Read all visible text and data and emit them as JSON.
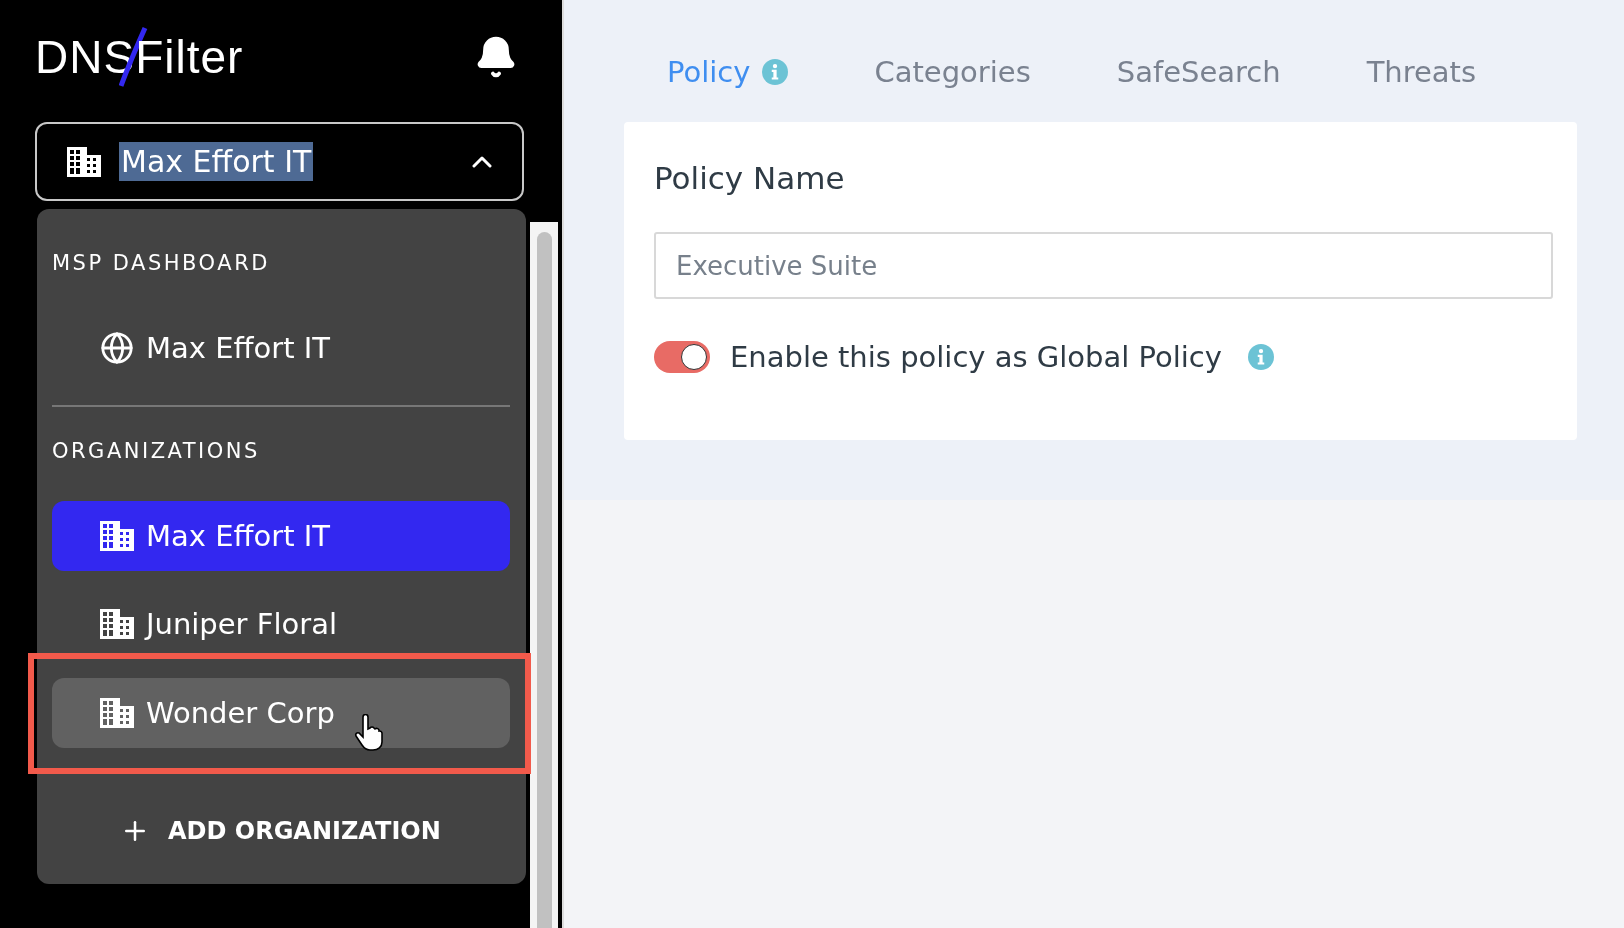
{
  "logo": {
    "left": "DNS",
    "right": "Filter"
  },
  "org_switcher": {
    "label": "Max Effort IT",
    "text_selected": true,
    "expanded": true
  },
  "menu": {
    "sections": [
      {
        "title": "MSP DASHBOARD",
        "items": [
          {
            "kind": "msp",
            "label": "Max Effort IT",
            "selected": false,
            "hovered": false,
            "highlighted": false
          }
        ]
      },
      {
        "title": "ORGANIZATIONS",
        "items": [
          {
            "kind": "org",
            "label": "Max Effort IT",
            "selected": true,
            "hovered": false,
            "highlighted": false
          },
          {
            "kind": "org",
            "label": "Juniper Floral",
            "selected": false,
            "hovered": false,
            "highlighted": false
          },
          {
            "kind": "org",
            "label": "Wonder Corp",
            "selected": false,
            "hovered": true,
            "highlighted": true
          }
        ]
      }
    ],
    "add_button": "ADD ORGANIZATION"
  },
  "tabs": [
    {
      "label": "Policy",
      "selected": true,
      "info": true
    },
    {
      "label": "Categories",
      "selected": false,
      "info": false
    },
    {
      "label": "SafeSearch",
      "selected": false,
      "info": false
    },
    {
      "label": "Threats",
      "selected": false,
      "info": false
    }
  ],
  "policy_card": {
    "title": "Policy Name",
    "name_field": {
      "placeholder": "Executive Suite"
    },
    "global_toggle": {
      "on": true,
      "label": "Enable this policy as Global Policy",
      "info": true
    }
  }
}
